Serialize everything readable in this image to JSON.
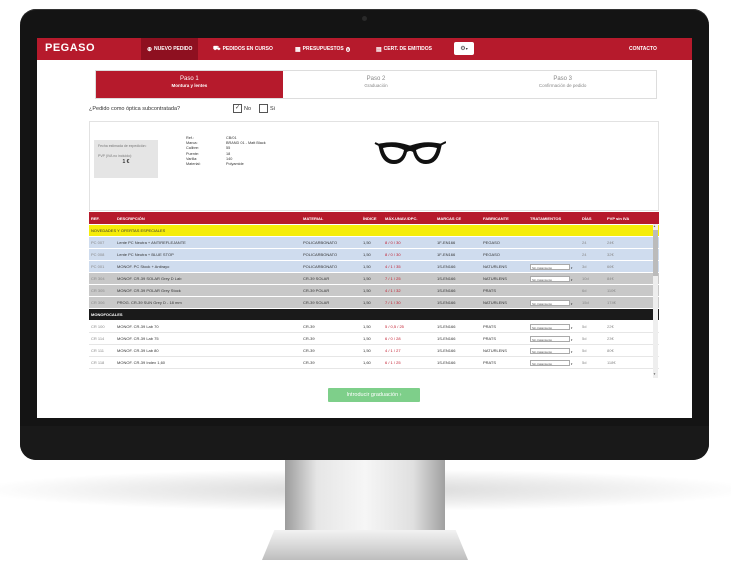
{
  "nav": {
    "logo": "PEGASO",
    "items": [
      {
        "label": "NUEVO PEDIDO",
        "icon": "plus-circle-icon"
      },
      {
        "label": "PEDIDOS EN CURSO",
        "icon": "truck-icon"
      },
      {
        "label": "PRESUPUESTOS",
        "icon": "calculator-icon",
        "badge": "0"
      },
      {
        "label": "CERT. DE EMITIDOS",
        "icon": "document-icon"
      }
    ],
    "gear": "gear-icon",
    "contact": "CONTACTO"
  },
  "steps": [
    {
      "title": "Paso 1",
      "subtitle": "Montura y lentes"
    },
    {
      "title": "Paso 2",
      "subtitle": "Graduación"
    },
    {
      "title": "Paso 3",
      "subtitle": "Confirmación de pedido"
    }
  ],
  "subcontract": {
    "question": "¿Pedido como óptica subcontratada?",
    "no": "No",
    "si": "Si",
    "no_checked": "✓"
  },
  "product": {
    "delivery_label": "Fecha estimada de expedición:",
    "pvp_label": "PVP (IVA no incluido):",
    "pvp_value": "1 €",
    "specs": [
      {
        "k": "Ref.:",
        "v": "CB/01"
      },
      {
        "k": "Marca:",
        "v": "BRAND 01 - Matt Black"
      },
      {
        "k": "Calibre:",
        "v": "55"
      },
      {
        "k": "Puente:",
        "v": "18"
      },
      {
        "k": "Varilla:",
        "v": "140"
      },
      {
        "k": "Material:",
        "v": "Polyamide"
      }
    ]
  },
  "table": {
    "headers": [
      "REF.",
      "DESCRIPCIÓN",
      "MATERIAL",
      "ÍNDICE",
      "MÁX.UNAV./DPC.",
      "MARCAS CE",
      "FABRICANTE",
      "TRATAMIENTOS",
      "DÍAS",
      "PVP sin IVA"
    ],
    "section1": "NOVEDADES Y OFERTAS ESPECIALES",
    "section2": "MONOFOCALES",
    "rows_special": [
      {
        "ref": "PC 007",
        "desc": "Lente PC Neutra + ANTIREFLEJANTE",
        "mat": "POLICARBONATO",
        "idx": "1,50",
        "max": "8 / 0 / 30",
        "ce": "1F-EN166",
        "fab": "PEGASO",
        "trat": "",
        "dias": "24",
        "pvp": "24€",
        "style": "blue"
      },
      {
        "ref": "PC 008",
        "desc": "Lente PC Neutra + BLUE STOP",
        "mat": "POLICARBONATO",
        "idx": "1,50",
        "max": "8 / 0 / 30",
        "ce": "1F-EN166",
        "fab": "PEGASO",
        "trat": "",
        "dias": "24",
        "pvp": "32€",
        "style": "blue"
      },
      {
        "ref": "PC 001",
        "desc": "MONOF. PC Stock + Antirayo",
        "mat": "POLICARBONATO",
        "idx": "1,50",
        "max": "4 / 1 / 35",
        "ce": "1S-EN166",
        "fab": "NATURLENS",
        "trat": "Sin tratamiento",
        "dias": "3d",
        "pvp": "66€",
        "style": "blue"
      },
      {
        "ref": "CR 304",
        "desc": "MONOF. CR-39 SOLAR Grey D Lab",
        "mat": "CR-39 SOLAR",
        "idx": "1,50",
        "max": "7 / 1 / 25",
        "ce": "1S-EN166",
        "fab": "NATURLENS",
        "trat": "Sin tratamiento",
        "dias": "10d",
        "pvp": "84€",
        "style": "gray"
      },
      {
        "ref": "CR 305",
        "desc": "MONOF. CR-39 POLAR Grey Stock",
        "mat": "CR-39 POLAR",
        "idx": "1,50",
        "max": "4 / 1 / 32",
        "ce": "1S-EN166",
        "fab": "PRATS",
        "trat": "",
        "dias": "6d",
        "pvp": "110€",
        "style": "gray"
      },
      {
        "ref": "CR 306",
        "desc": "PROG. CR-39 SUN Grey D - 18 mm",
        "mat": "CR-39 SOLAR",
        "idx": "1,50",
        "max": "7 / 1 / 30",
        "ce": "1S-EN166",
        "fab": "NATURLENS",
        "trat": "Sin tratamiento",
        "dias": "15d",
        "pvp": "174€",
        "style": "gray"
      }
    ],
    "rows_mono": [
      {
        "ref": "CR 100",
        "desc": "MONOF. CR-39 Lab 70",
        "mat": "CR-39",
        "idx": "1,50",
        "max": "5 / 0,5 / 25",
        "ce": "1S-EN166",
        "fab": "PRATS",
        "trat": "Sin tratamiento",
        "dias": "5d",
        "pvp": "22€",
        "style": "white"
      },
      {
        "ref": "CR 114",
        "desc": "MONOF. CR-39 Lab 75",
        "mat": "CR-39",
        "idx": "1,50",
        "max": "6 / 0 / 28",
        "ce": "1S-EN166",
        "fab": "PRATS",
        "trat": "Sin tratamiento",
        "dias": "5d",
        "pvp": "23€",
        "style": "white"
      },
      {
        "ref": "CR 111",
        "desc": "MONOF. CR-39 Lab 80",
        "mat": "CR-39",
        "idx": "1,50",
        "max": "4 / 1 / 27",
        "ce": "1S-EN166",
        "fab": "NATURLENS",
        "trat": "Sin tratamiento",
        "dias": "5d",
        "pvp": "80€",
        "style": "white"
      },
      {
        "ref": "CR 118",
        "desc": "MONOF. CR-39 Index 1,60",
        "mat": "CR-39",
        "idx": "1,60",
        "max": "6 / 1 / 25",
        "ce": "1S-EN166",
        "fab": "PRATS",
        "trat": "Sin tratamiento",
        "dias": "5d",
        "pvp": "118€",
        "style": "white"
      }
    ]
  },
  "cta": "Introducir graduación",
  "colors": {
    "brand": "#b61a2c",
    "yellow": "#f5ec0a",
    "green": "#7ecf8a"
  }
}
